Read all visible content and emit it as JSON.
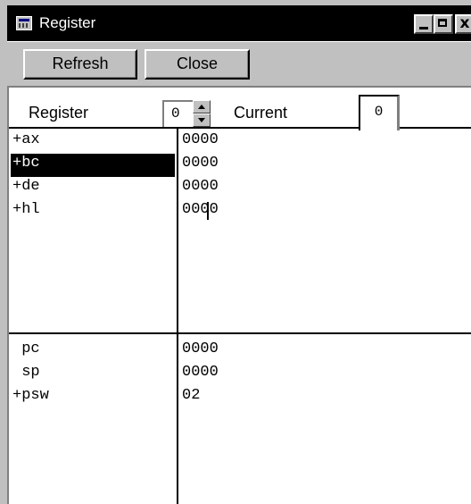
{
  "window": {
    "title": "Register",
    "controls": {
      "minimize": "_",
      "maximize": "□",
      "close": "x"
    }
  },
  "toolbar": {
    "refresh_label": "Refresh",
    "close_label": "Close"
  },
  "register_bar": {
    "register_label": "Register",
    "register_value": "0",
    "current_label": "Current",
    "current_value": "0"
  },
  "general_registers": [
    {
      "name": "+ax",
      "value": "0000",
      "selected": false
    },
    {
      "name": "+bc",
      "value": "0000",
      "selected": true
    },
    {
      "name": "+de",
      "value": "0000",
      "selected": false
    },
    {
      "name": "+hl",
      "value": "0000",
      "selected": false
    }
  ],
  "control_registers": [
    {
      "name": " pc",
      "value": "0000"
    },
    {
      "name": " sp",
      "value": "0000"
    },
    {
      "name": "+psw",
      "value": "02"
    }
  ],
  "colors": {
    "titlebar": "#000000",
    "face": "#c0c0c0",
    "selection": "#000000"
  }
}
